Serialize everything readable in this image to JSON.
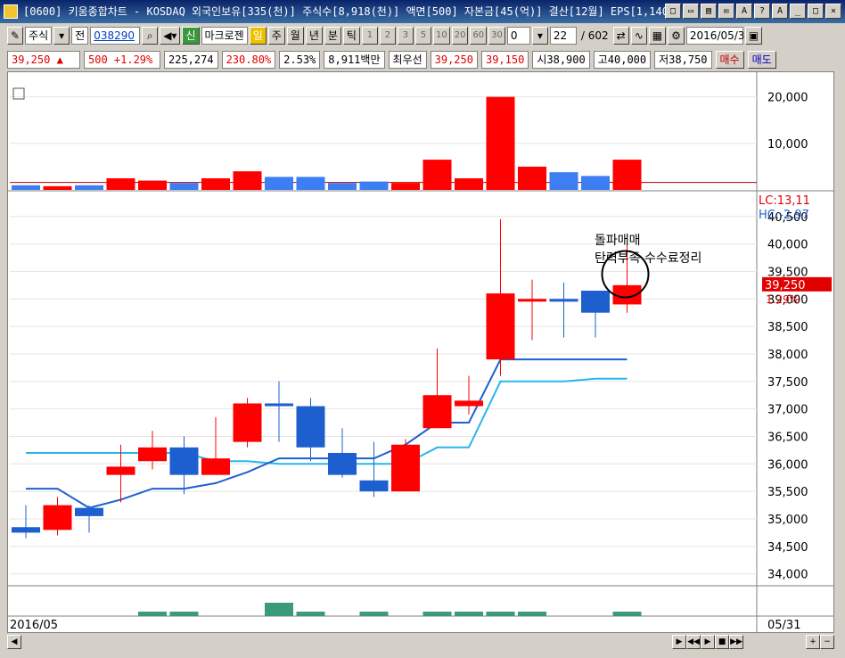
{
  "window": {
    "title": "[0600] 키움종합차트 - KOSDAQ 외국인보유[335(천)] 주식수[8,918(천)] 액면[500] 자본금[45(억)] 결산[12월] EPS[1,140",
    "buttons": [
      "□",
      "▭",
      "▤",
      "✉",
      "A",
      "?",
      "A",
      "_",
      "□",
      "×"
    ]
  },
  "toolbar": {
    "market": "주식",
    "prev": "전",
    "code": "038290",
    "stock_name": "마크로젠",
    "tag_new": "신",
    "tag_day": "일",
    "periods": [
      "주",
      "월",
      "년",
      "분",
      "틱"
    ],
    "minute_options": [
      "1",
      "2",
      "3",
      "5",
      "10",
      "20",
      "60",
      "30",
      "0"
    ],
    "count": "22",
    "total": "/ 602",
    "date": "2016/05/3"
  },
  "quote": {
    "price": "39,250 ▲",
    "change": "500 +1.29%",
    "volume": "225,274",
    "volume_ratio": "230.80%",
    "turnover": "2.53%",
    "amount": "8,911백만",
    "best_bid_label": "최우선",
    "ask": "39,250",
    "bid": "39,150",
    "open": "시38,900",
    "high": "고40,000",
    "low": "저38,750",
    "buy_label": "매수",
    "sell_label": "매도"
  },
  "chart_data": {
    "type": "candlestick",
    "dates_visible": [
      "2016/05",
      "05/31"
    ],
    "candles": [
      {
        "open": 34850,
        "close": 34750,
        "high": 35250,
        "low": 34650
      },
      {
        "open": 34800,
        "close": 35250,
        "high": 35400,
        "low": 34700
      },
      {
        "open": 35200,
        "close": 35050,
        "high": 35250,
        "low": 34750
      },
      {
        "open": 35800,
        "close": 35950,
        "high": 36350,
        "low": 35300
      },
      {
        "open": 36050,
        "close": 36300,
        "high": 36600,
        "low": 35900
      },
      {
        "open": 36300,
        "close": 35800,
        "high": 36500,
        "low": 35450
      },
      {
        "open": 35800,
        "close": 36100,
        "high": 36850,
        "low": 35800
      },
      {
        "open": 36400,
        "close": 37100,
        "high": 37200,
        "low": 36300
      },
      {
        "open": 37100,
        "close": 37050,
        "high": 37500,
        "low": 36400
      },
      {
        "open": 37050,
        "close": 36300,
        "high": 37200,
        "low": 36050
      },
      {
        "open": 36200,
        "close": 35800,
        "high": 36650,
        "low": 35750
      },
      {
        "open": 35700,
        "close": 35500,
        "high": 36400,
        "low": 35400
      },
      {
        "open": 35500,
        "close": 36350,
        "high": 36450,
        "low": 35500
      },
      {
        "open": 36650,
        "close": 37250,
        "high": 38100,
        "low": 36650
      },
      {
        "open": 37050,
        "close": 37150,
        "high": 37600,
        "low": 36900
      },
      {
        "open": 37900,
        "close": 39100,
        "high": 40450,
        "low": 37600
      },
      {
        "open": 39000,
        "close": 39000,
        "high": 39350,
        "low": 38250
      },
      {
        "open": 39000,
        "close": 38950,
        "high": 39300,
        "low": 38300
      },
      {
        "open": 39150,
        "close": 38750,
        "high": 39150,
        "low": 38300
      },
      {
        "open": 38900,
        "close": 39250,
        "high": 40000,
        "low": 38750
      }
    ],
    "ma_short": [
      35550,
      35550,
      35200,
      35350,
      35550,
      35550,
      35650,
      35850,
      36100,
      36100,
      36100,
      36100,
      36350,
      36750,
      36750,
      37900,
      37900,
      37900,
      37900,
      37900
    ],
    "ma_long": [
      36200,
      36200,
      36200,
      36200,
      36200,
      36200,
      36050,
      36050,
      36000,
      36000,
      36000,
      36000,
      36000,
      36300,
      36300,
      37500,
      37500,
      37500,
      37550,
      37550
    ],
    "volume": [
      1,
      0.8,
      1,
      2.5,
      2.0,
      1.5,
      2.5,
      4.0,
      2.8,
      2.8,
      1.5,
      1.8,
      1.5,
      6.5,
      2.5,
      20.0,
      5.0,
      3.8,
      3.0,
      6.5
    ],
    "volume_ticks": [
      "20,000",
      "10,000"
    ],
    "price_ticks": [
      "40,500",
      "40,000",
      "39,500",
      "39,000",
      "38,500",
      "38,000",
      "37,500",
      "37,000",
      "36,500",
      "36,000",
      "35,500",
      "35,000",
      "34,500",
      "34,000"
    ],
    "ylim": [
      33800,
      40950
    ],
    "lc": "LC:13,11",
    "hc": "HC:-2,97",
    "last_price": "39,250",
    "last_change": "1.29%",
    "annotation_line1": "돌파매매",
    "annotation_line2": "탄력부족 수수료정리",
    "indicator": [
      0,
      0,
      0,
      0,
      0.5,
      0.5,
      0,
      0,
      1.5,
      0.5,
      0,
      0.5,
      0,
      0.5,
      0.5,
      0.5,
      0.5,
      0,
      0,
      0.5
    ],
    "colors": {
      "up": "#ff0000",
      "down": "#1e5fcf",
      "ma_short": "#1e5fcf",
      "ma_long": "#29b6e8",
      "indicator": "#3a9a7a",
      "vol_line": "#c00000"
    }
  }
}
